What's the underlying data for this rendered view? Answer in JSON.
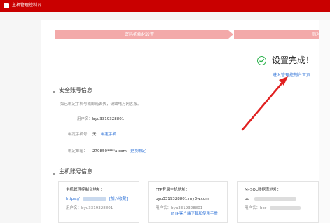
{
  "header": {
    "title": "主机管理控制台"
  },
  "steps": [
    {
      "label": "密码初始化设置"
    },
    {
      "label": "账号设"
    }
  ],
  "completion": {
    "title": "设置完成！",
    "link": "进入管理控制台首页"
  },
  "security": {
    "section_title": "安全账号信息",
    "notice": "如已绑定手机号或邮箱丢失，请致电万网客服。",
    "username_label": "用户名：",
    "username_value": "byu3319328801",
    "phone_label": "绑定手机号：",
    "phone_value": "无",
    "phone_action": "绑定手机",
    "email_label": "绑定邮箱：",
    "email_value": "270850****a.com",
    "email_action": "更换绑定"
  },
  "host_account": {
    "section_title": "主机账号信息",
    "cards": [
      {
        "title": "主机管理控制台地址：",
        "url": "https://",
        "action": "[加入收藏]",
        "user_label": "用户名：",
        "user_value": "byu3319328801"
      },
      {
        "title": "FTP登录主机地址：",
        "url": "byu3319328801.my3w.com",
        "user_label": "用户名：",
        "user_value": "byu3319328801",
        "action": "[FTP客户端下载和使用手册]"
      },
      {
        "title": "MySQL数据库地址：",
        "url": "bd",
        "user_label": "用户名：",
        "user_value": "bor"
      }
    ]
  },
  "colors": {
    "topbar": "#c90000",
    "step": "#f3a9a9",
    "link": "#2a6fd6",
    "success": "#2bb24c",
    "annotation_arrow": "#e02020"
  }
}
